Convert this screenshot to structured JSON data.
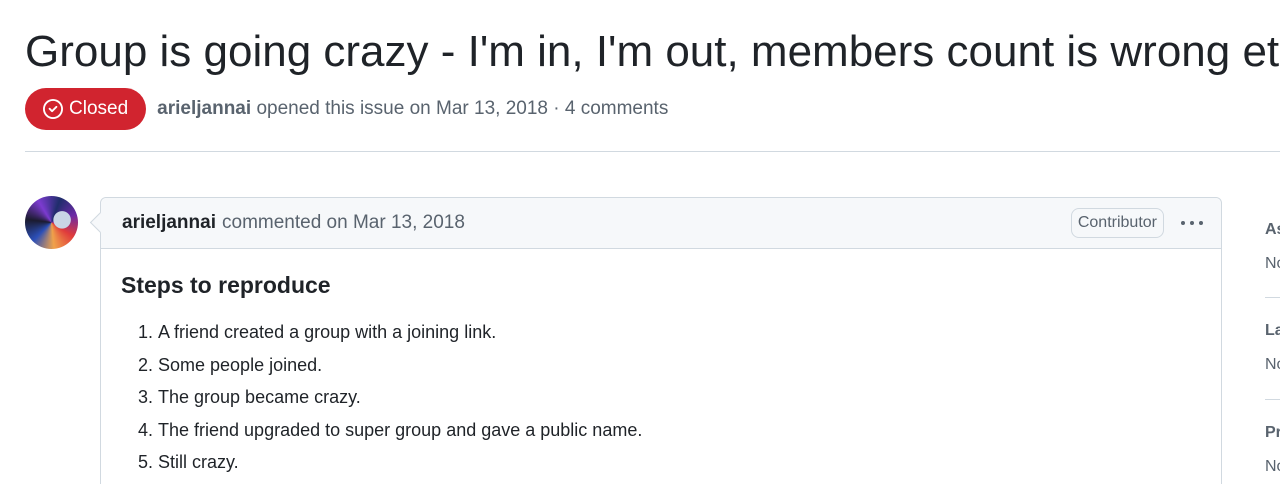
{
  "issue": {
    "title": "Group is going crazy - I'm in, I'm out, members count is wrong etc.",
    "number": "#",
    "state": "Closed",
    "author": "arieljannai",
    "opened_text": "opened this issue on Mar 13, 2018 · 4 comments"
  },
  "comment": {
    "author": "arieljannai",
    "meta": "commented on Mar 13, 2018",
    "role": "Contributor",
    "heading": "Steps to reproduce",
    "steps": [
      "A friend created a group with a joining link.",
      "Some people joined.",
      "The group became crazy.",
      "The friend upgraded to super group and gave a public name.",
      "Still crazy."
    ]
  },
  "sidebar": {
    "sections": [
      {
        "heading": "Assignees",
        "value": "No one assigned"
      },
      {
        "heading": "Labels",
        "value": "None yet"
      },
      {
        "heading": "Projects",
        "value": "None yet"
      }
    ]
  },
  "colors": {
    "closed_badge": "#d1242f",
    "border": "#d1d9e0",
    "muted_text": "#59636e",
    "header_bg": "#f6f8fa"
  }
}
